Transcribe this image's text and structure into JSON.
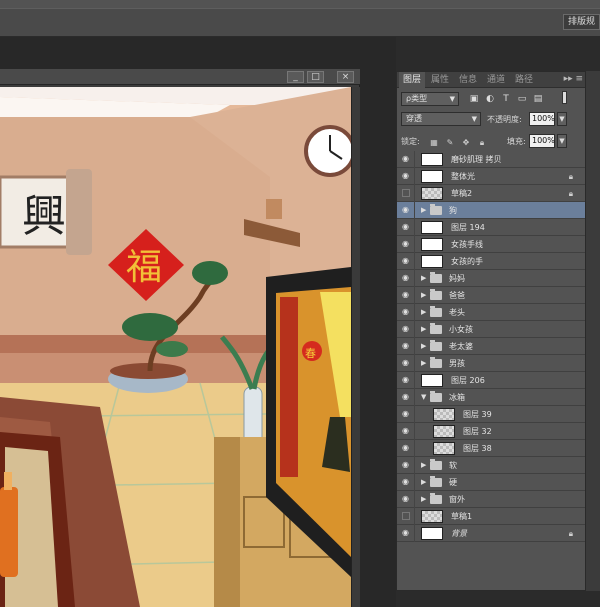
{
  "options_bar": {
    "layout_button_label": "排版规"
  },
  "document": {
    "window_buttons": [
      "_",
      "□",
      "×"
    ],
    "canvas_text": {
      "calligraphy": "興",
      "fu_character": "福",
      "tv_character": "春"
    }
  },
  "layers_panel": {
    "tabs": [
      {
        "label": "图层",
        "active": true
      },
      {
        "label": "属性",
        "active": false
      },
      {
        "label": "信息",
        "active": false
      },
      {
        "label": "通道",
        "active": false
      },
      {
        "label": "路径",
        "active": false
      }
    ],
    "menu_icon": "▸▸ ≡",
    "filter": {
      "label": "ρ类型",
      "icons": [
        "image-filter-icon",
        "adjustment-filter-icon",
        "type-filter-icon",
        "shape-filter-icon",
        "smart-object-filter-icon"
      ]
    },
    "blend_mode": "穿透",
    "opacity_label": "不透明度:",
    "opacity_value": "100%",
    "lock_label": "锁定:",
    "fill_label": "填充:",
    "fill_value": "100%",
    "layers": [
      {
        "name": "磨砂肌理 拷贝",
        "visible": true,
        "type": "layer",
        "thumb": "white",
        "locked": false,
        "indent": 0
      },
      {
        "name": "整体光",
        "visible": true,
        "type": "layer",
        "thumb": "white",
        "locked": true,
        "indent": 0
      },
      {
        "name": "草稿2",
        "visible": false,
        "type": "layer",
        "thumb": "checker",
        "locked": true,
        "indent": 0
      },
      {
        "name": "狗",
        "visible": true,
        "type": "group",
        "expanded": false,
        "selected": true,
        "indent": 0
      },
      {
        "name": "图层 194",
        "visible": true,
        "type": "layer",
        "thumb": "white",
        "locked": false,
        "indent": 0
      },
      {
        "name": "女孩手线",
        "visible": true,
        "type": "layer",
        "thumb": "white",
        "locked": false,
        "indent": 0
      },
      {
        "name": "女孩的手",
        "visible": true,
        "type": "layer",
        "thumb": "white",
        "locked": false,
        "indent": 0
      },
      {
        "name": "妈妈",
        "visible": true,
        "type": "group",
        "expanded": false,
        "indent": 0
      },
      {
        "name": "爸爸",
        "visible": true,
        "type": "group",
        "expanded": false,
        "indent": 0
      },
      {
        "name": "老头",
        "visible": true,
        "type": "group",
        "expanded": false,
        "indent": 0
      },
      {
        "name": "小女孩",
        "visible": true,
        "type": "group",
        "expanded": false,
        "indent": 0
      },
      {
        "name": "老太婆",
        "visible": true,
        "type": "group",
        "expanded": false,
        "indent": 0
      },
      {
        "name": "男孩",
        "visible": true,
        "type": "group",
        "expanded": false,
        "indent": 0
      },
      {
        "name": "图层 206",
        "visible": true,
        "type": "layer",
        "thumb": "white",
        "locked": false,
        "indent": 0
      },
      {
        "name": "冰箱",
        "visible": true,
        "type": "group",
        "expanded": true,
        "indent": 0
      },
      {
        "name": "图层 39",
        "visible": true,
        "type": "layer",
        "thumb": "checker",
        "locked": false,
        "indent": 1
      },
      {
        "name": "图层 32",
        "visible": true,
        "type": "layer",
        "thumb": "checker",
        "locked": false,
        "indent": 1
      },
      {
        "name": "图层 38",
        "visible": true,
        "type": "layer",
        "thumb": "checker",
        "locked": false,
        "indent": 1
      },
      {
        "name": "软",
        "visible": true,
        "type": "group",
        "expanded": false,
        "indent": 0
      },
      {
        "name": "硬",
        "visible": true,
        "type": "group",
        "expanded": false,
        "indent": 0
      },
      {
        "name": "窗外",
        "visible": true,
        "type": "group",
        "expanded": false,
        "indent": 0
      },
      {
        "name": "草稿1",
        "visible": false,
        "type": "layer",
        "thumb": "checker",
        "locked": false,
        "indent": 0
      },
      {
        "name": "背景",
        "visible": true,
        "type": "layer",
        "thumb": "white",
        "locked": true,
        "indent": 0,
        "italic": true
      }
    ]
  }
}
